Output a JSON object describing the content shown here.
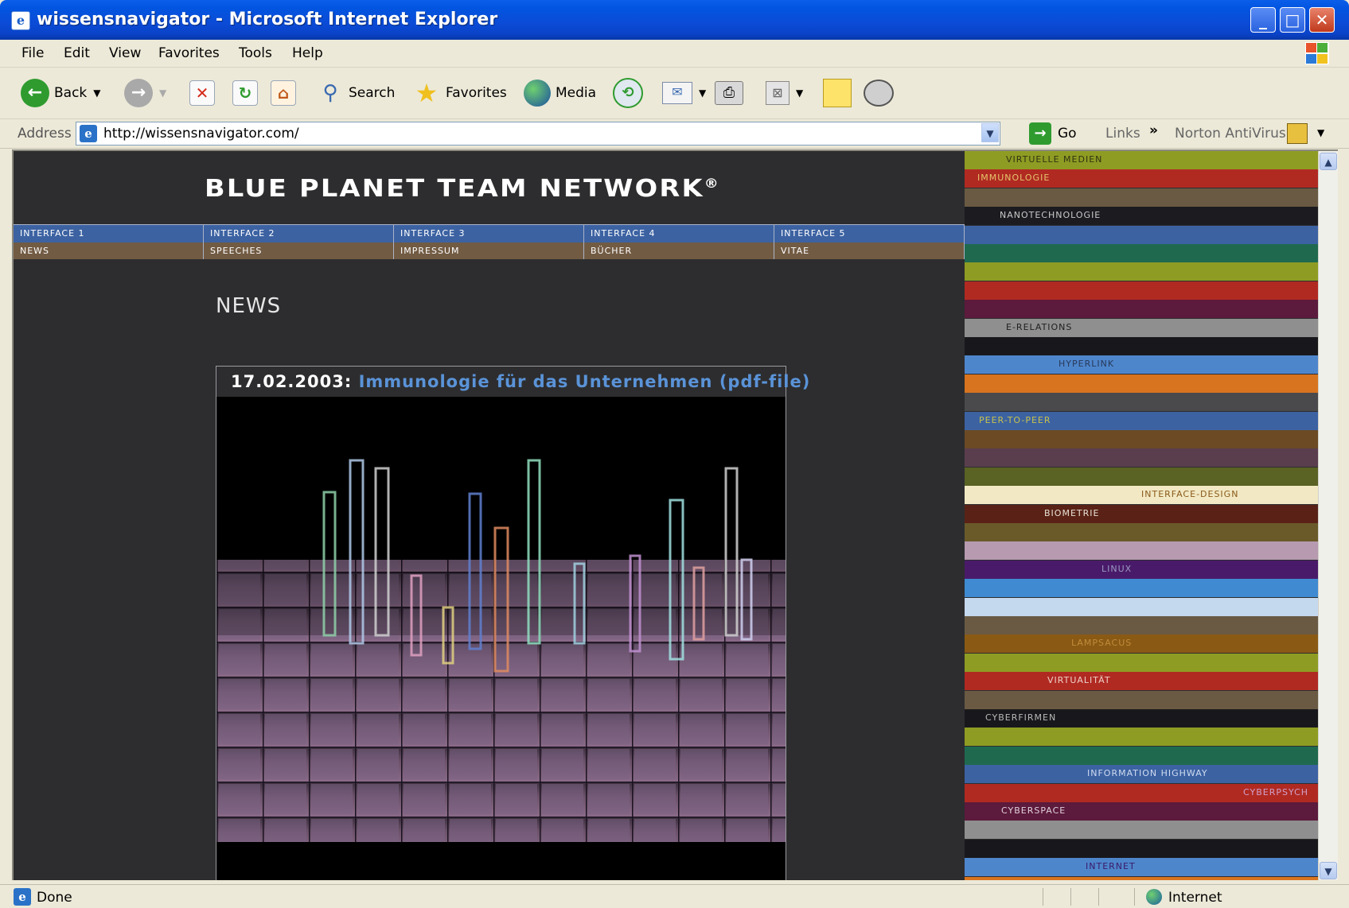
{
  "window": {
    "title": "wissensnavigator - Microsoft Internet Explorer",
    "min_glyph": "_",
    "max_glyph": "□",
    "close_glyph": "✕"
  },
  "menu": [
    "File",
    "Edit",
    "View",
    "Favorites",
    "Tools",
    "Help"
  ],
  "toolbar": {
    "back": "Back",
    "search": "Search",
    "favorites": "Favorites",
    "media": "Media"
  },
  "address": {
    "label": "Address",
    "url": "http://wissensnavigator.com/",
    "go": "Go",
    "links": "Links",
    "norton": "Norton AntiVirus"
  },
  "site": {
    "title": "BLUE PLANET TEAM NETWORK",
    "title_mark": "®",
    "nav_primary": [
      "INTERFACE 1",
      "INTERFACE 2",
      "INTERFACE 3",
      "INTERFACE 4",
      "INTERFACE 5"
    ],
    "nav_secondary": [
      "NEWS",
      "SPEECHES",
      "IMPRESSUM",
      "BÜCHER",
      "VITAE"
    ],
    "section_title": "NEWS",
    "news": {
      "date": "17.02.2003:",
      "link_text": "Immunologie für das Unternehmen (pdf-file)"
    }
  },
  "sidebar": [
    {
      "label": "VIRTUELLE MEDIEN",
      "bg": "#8f9c23",
      "fg": "#2f3410",
      "indent": 52
    },
    {
      "label": "IMMUNOLOGIE",
      "bg": "#b02a22",
      "fg": "#e6c36a",
      "indent": 16
    },
    {
      "label": "",
      "bg": "#6a5a43",
      "fg": "#fff",
      "indent": 0
    },
    {
      "label": "NANOTECHNOLOGIE",
      "bg": "#1b1b20",
      "fg": "#c9c9c9",
      "indent": 44
    },
    {
      "label": "",
      "bg": "#3c62a2",
      "fg": "#fff",
      "indent": 0
    },
    {
      "label": "",
      "bg": "#1f6a4f",
      "fg": "#fff",
      "indent": 0
    },
    {
      "label": "",
      "bg": "#8f9c23",
      "fg": "#fff",
      "indent": 0
    },
    {
      "label": "",
      "bg": "#b02a22",
      "fg": "#fff",
      "indent": 0
    },
    {
      "label": "",
      "bg": "#5c1a3c",
      "fg": "#fff",
      "indent": 0
    },
    {
      "label": "E-RELATIONS",
      "bg": "#8f8f8f",
      "fg": "#202020",
      "indent": 52
    },
    {
      "label": "",
      "bg": "#18181c",
      "fg": "#fff",
      "indent": 0
    },
    {
      "label": "HYPERLINK",
      "bg": "#4e86cc",
      "fg": "#283a5a",
      "indent": 118
    },
    {
      "label": "",
      "bg": "#d8741f",
      "fg": "#fff",
      "indent": 0
    },
    {
      "label": "",
      "bg": "#4a4a4c",
      "fg": "#fff",
      "indent": 0
    },
    {
      "label": "PEER-TO-PEER",
      "bg": "#3c62a2",
      "fg": "#c7c24a",
      "indent": 18
    },
    {
      "label": "",
      "bg": "#6b4a24",
      "fg": "#fff",
      "indent": 0
    },
    {
      "label": "",
      "bg": "#5a3e4e",
      "fg": "#fff",
      "indent": 0
    },
    {
      "label": "",
      "bg": "#5a6224",
      "fg": "#fff",
      "indent": 0
    },
    {
      "label": "INTERFACE-DESIGN",
      "bg": "#f2e9c4",
      "fg": "#8a5a1a",
      "indent": 222
    },
    {
      "label": "BIOMETRIE",
      "bg": "#5a2216",
      "fg": "#e8e0d6",
      "indent": 100
    },
    {
      "label": "",
      "bg": "#6a5a2a",
      "fg": "#fff",
      "indent": 0
    },
    {
      "label": "",
      "bg": "#b79ab0",
      "fg": "#fff",
      "indent": 0
    },
    {
      "label": "LINUX",
      "bg": "#4a1a6a",
      "fg": "#9a9ac0",
      "indent": 172
    },
    {
      "label": "",
      "bg": "#3f8ad0",
      "fg": "#fff",
      "indent": 0
    },
    {
      "label": "",
      "bg": "#c4d8ee",
      "fg": "#fff",
      "indent": 0
    },
    {
      "label": "",
      "bg": "#6a5a43",
      "fg": "#fff",
      "indent": 0
    },
    {
      "label": "LAMPSACUS",
      "bg": "#8a5a14",
      "fg": "#c08a3a",
      "indent": 134
    },
    {
      "label": "",
      "bg": "#8f9c23",
      "fg": "#fff",
      "indent": 0
    },
    {
      "label": "VIRTUALITÄT",
      "bg": "#b02a22",
      "fg": "#eed0c8",
      "indent": 104
    },
    {
      "label": "",
      "bg": "#6a5a43",
      "fg": "#fff",
      "indent": 0
    },
    {
      "label": "CYBERFIRMEN",
      "bg": "#18181c",
      "fg": "#b8b8b8",
      "indent": 26
    },
    {
      "label": "",
      "bg": "#8f9c23",
      "fg": "#fff",
      "indent": 0
    },
    {
      "label": "",
      "bg": "#1f6a4f",
      "fg": "#fff",
      "indent": 0
    },
    {
      "label": "INFORMATION HIGHWAY",
      "bg": "#3c62a2",
      "fg": "#cfdcf0",
      "indent": 154
    },
    {
      "label": "CYBERPSYCH",
      "bg": "#b02a22",
      "fg": "#d2a0c8",
      "indent": 350
    },
    {
      "label": "CYBERSPACE",
      "bg": "#5c1a3c",
      "fg": "#e0d0da",
      "indent": 46
    },
    {
      "label": "",
      "bg": "#8f8f8f",
      "fg": "#fff",
      "indent": 0
    },
    {
      "label": "",
      "bg": "#18181c",
      "fg": "#fff",
      "indent": 0
    },
    {
      "label": "INTERNET",
      "bg": "#4e86cc",
      "fg": "#3a1a6a",
      "indent": 152
    },
    {
      "label": "",
      "bg": "#d8741f",
      "fg": "#fff",
      "indent": 0
    }
  ],
  "status": {
    "text": "Done",
    "zone": "Internet"
  }
}
